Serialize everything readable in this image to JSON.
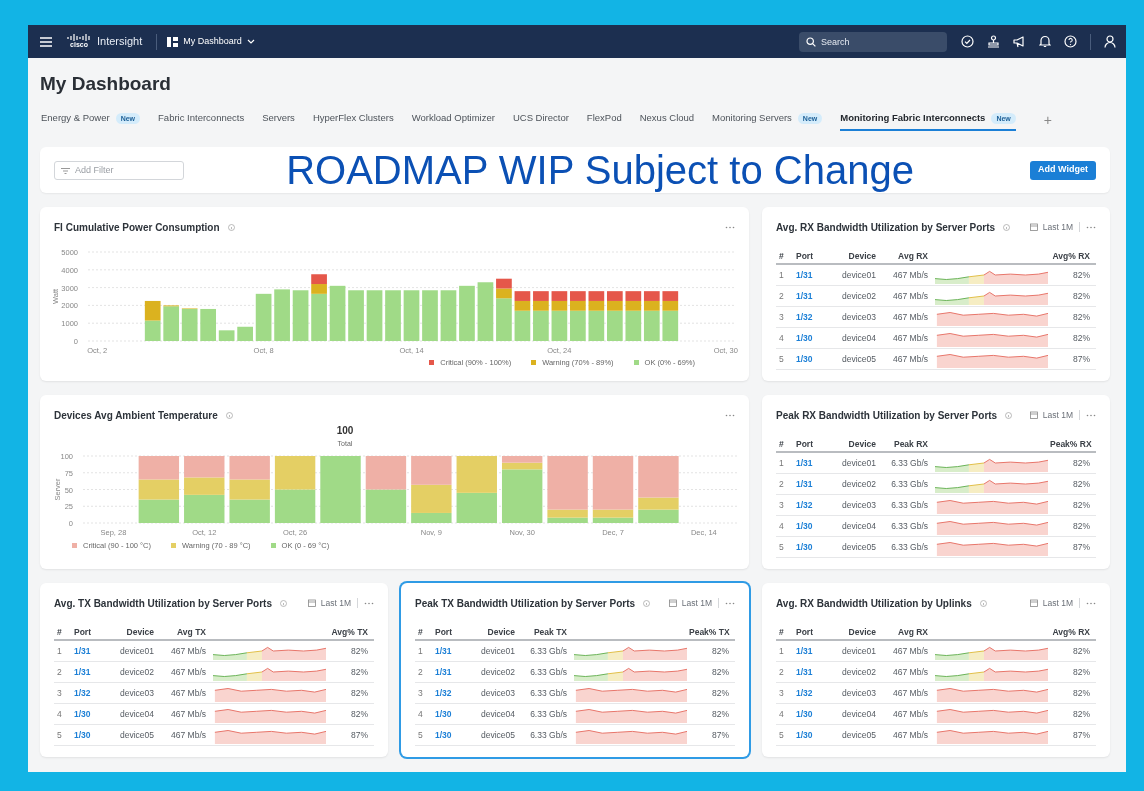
{
  "top_bar": {
    "logo_text": "cisco",
    "product": "Intersight",
    "dashboard_menu": "My Dashboard",
    "search": {
      "placeholder": "Search"
    }
  },
  "page_title": "My Dashboard",
  "tabs": [
    {
      "label": "Energy & Power",
      "badge": "New",
      "selected": false
    },
    {
      "label": "Fabric Interconnects",
      "selected": false
    },
    {
      "label": "Servers",
      "selected": false
    },
    {
      "label": "HyperFlex Clusters",
      "selected": false
    },
    {
      "label": "Workload Optimizer",
      "selected": false
    },
    {
      "label": "UCS Director",
      "selected": false
    },
    {
      "label": "FlexPod",
      "selected": false
    },
    {
      "label": "Nexus Cloud",
      "selected": false
    },
    {
      "label": "Monitoring Servers",
      "badge": "New",
      "selected": false
    },
    {
      "label": "Monitoring Fabric Interconnects",
      "badge": "New",
      "selected": true
    }
  ],
  "add_tab": "+",
  "filter": {
    "placeholder": "Add Filter"
  },
  "add_widget_button": "Add Widget",
  "overlay_notice": "ROADMAP WIP Subject to Change",
  "widgets": [
    {
      "kind": "chart",
      "selected": false,
      "chart_data": {
        "type": "bar",
        "title": "FI Cumulative Power Consumption",
        "ylabel": "Watt",
        "stacked": true,
        "grid": true,
        "ylim": [
          0,
          5000
        ],
        "yticks": [
          0,
          1000,
          2000,
          3000,
          4000,
          5000
        ],
        "categories": [
          "Oct, 2",
          null,
          null,
          null,
          null,
          null,
          null,
          null,
          null,
          "Oct, 8",
          null,
          null,
          null,
          null,
          null,
          null,
          null,
          "Oct, 14",
          null,
          null,
          null,
          null,
          null,
          null,
          null,
          "Oct, 24",
          null,
          null,
          null,
          null,
          null,
          null,
          null,
          null,
          "Oct, 30"
        ],
        "series": [
          {
            "name": "Critical (90% - 100%)",
            "color": "#e5574a",
            "values": [
              null,
              null,
              null,
              0,
              0,
              0,
              0,
              0,
              0,
              0,
              0,
              0,
              550,
              0,
              0,
              0,
              0,
              0,
              0,
              0,
              0,
              0,
              550,
              550,
              550,
              550,
              550,
              550,
              550,
              550,
              550,
              550,
              null,
              null,
              null
            ]
          },
          {
            "name": "Warning (70% - 89%)",
            "color": "#dbb21f",
            "values": [
              null,
              null,
              null,
              1100,
              50,
              30,
              0,
              0,
              0,
              0,
              0,
              0,
              550,
              0,
              0,
              0,
              0,
              0,
              0,
              0,
              0,
              0,
              550,
              550,
              550,
              550,
              550,
              550,
              550,
              550,
              550,
              550,
              null,
              null,
              null
            ]
          },
          {
            "name": "OK (0% - 69%)",
            "color": "#a0da87",
            "values": [
              null,
              null,
              null,
              1150,
              1950,
              1800,
              1800,
              600,
              800,
              2650,
              2900,
              2850,
              2650,
              3100,
              2850,
              2850,
              2850,
              2850,
              2850,
              2850,
              3100,
              3300,
              2400,
              1700,
              1700,
              1700,
              1700,
              1700,
              1700,
              1700,
              1700,
              1700,
              null,
              null,
              null
            ]
          }
        ]
      }
    },
    {
      "kind": "table",
      "title": "Avg. RX Bandwidth Utilization by Server Ports",
      "selected": false,
      "date_range": "Last 1M",
      "columns": [
        "#",
        "Port",
        "Device",
        "Avg RX",
        "Avg% RX"
      ],
      "rows": [
        {
          "index": "1",
          "port": "1/31",
          "device": "device01",
          "value": "467 Mb/s",
          "kind": "mixed",
          "percent": "82%"
        },
        {
          "index": "2",
          "port": "1/31",
          "device": "device02",
          "value": "467 Mb/s",
          "kind": "mixed",
          "percent": "82%"
        },
        {
          "index": "3",
          "port": "1/32",
          "device": "device03",
          "value": "467 Mb/s",
          "kind": "high",
          "percent": "82%"
        },
        {
          "index": "4",
          "port": "1/30",
          "device": "device04",
          "value": "467 Mb/s",
          "kind": "high",
          "percent": "82%"
        },
        {
          "index": "5",
          "port": "1/30",
          "device": "device05",
          "value": "467 Mb/s",
          "kind": "high",
          "percent": "87%"
        }
      ]
    },
    {
      "kind": "chart",
      "selected": false,
      "total": {
        "value": "100",
        "label": "Total"
      },
      "chart_data": {
        "type": "bar",
        "title": "Devices Avg Ambient Temperature",
        "ylabel": "Server",
        "stacked": true,
        "grid": true,
        "ylim": [
          0,
          100
        ],
        "yticks": [
          0,
          25,
          50,
          75,
          100
        ],
        "categories": [
          "Sep, 28",
          null,
          "Oct, 12",
          null,
          "Oct, 26",
          null,
          null,
          "Nov, 9",
          null,
          "Nov, 30",
          null,
          "Dec, 7",
          null,
          "Dec, 14"
        ],
        "series": [
          {
            "name": "Critical (90 - 100 °C)",
            "color": "#efb0a6",
            "values": [
              null,
              35,
              32,
              35,
              0,
              0,
              50,
              43,
              0,
              10,
              80,
              80,
              62,
              null
            ]
          },
          {
            "name": "Warning (70 - 89 °C)",
            "color": "#e4cf64",
            "values": [
              null,
              30,
              26,
              30,
              50,
              0,
              0,
              42,
              55,
              10,
              12,
              12,
              18,
              null
            ]
          },
          {
            "name": "OK (0 - 69 °C)",
            "color": "#a0da87",
            "values": [
              null,
              35,
              42,
              35,
              50,
              100,
              50,
              15,
              45,
              80,
              8,
              8,
              20,
              null
            ]
          }
        ]
      }
    },
    {
      "kind": "table",
      "title": "Peak RX Bandwidth Utilization by Server Ports",
      "selected": false,
      "date_range": "Last 1M",
      "columns": [
        "#",
        "Port",
        "Device",
        "Peak RX",
        "Peak% RX"
      ],
      "rows": [
        {
          "index": "1",
          "port": "1/31",
          "device": "device01",
          "value": "6.33 Gb/s",
          "kind": "mixed",
          "percent": "82%"
        },
        {
          "index": "2",
          "port": "1/31",
          "device": "device02",
          "value": "6.33 Gb/s",
          "kind": "mixed",
          "percent": "82%"
        },
        {
          "index": "3",
          "port": "1/32",
          "device": "device03",
          "value": "6.33 Gb/s",
          "kind": "high",
          "percent": "82%"
        },
        {
          "index": "4",
          "port": "1/30",
          "device": "device04",
          "value": "6.33 Gb/s",
          "kind": "high",
          "percent": "82%"
        },
        {
          "index": "5",
          "port": "1/30",
          "device": "device05",
          "value": "6.33 Gb/s",
          "kind": "high",
          "percent": "87%"
        }
      ]
    },
    {
      "kind": "table",
      "title": "Avg. TX Bandwidth Utilization by Server Ports",
      "selected": false,
      "date_range": "Last 1M",
      "columns": [
        "#",
        "Port",
        "Device",
        "Avg TX",
        "Avg% TX"
      ],
      "rows": [
        {
          "index": "1",
          "port": "1/31",
          "device": "device01",
          "value": "467 Mb/s",
          "kind": "mixed",
          "percent": "82%"
        },
        {
          "index": "2",
          "port": "1/31",
          "device": "device02",
          "value": "467 Mb/s",
          "kind": "mixed",
          "percent": "82%"
        },
        {
          "index": "3",
          "port": "1/32",
          "device": "device03",
          "value": "467 Mb/s",
          "kind": "high",
          "percent": "82%"
        },
        {
          "index": "4",
          "port": "1/30",
          "device": "device04",
          "value": "467 Mb/s",
          "kind": "high",
          "percent": "82%"
        },
        {
          "index": "5",
          "port": "1/30",
          "device": "device05",
          "value": "467 Mb/s",
          "kind": "high",
          "percent": "87%"
        }
      ]
    },
    {
      "kind": "table",
      "title": "Peak TX Bandwidth Utilization by Server Ports",
      "selected": true,
      "date_range": "Last 1M",
      "columns": [
        "#",
        "Port",
        "Device",
        "Peak TX",
        "Peak% TX"
      ],
      "rows": [
        {
          "index": "1",
          "port": "1/31",
          "device": "device01",
          "value": "6.33 Gb/s",
          "kind": "mixed",
          "percent": "82%"
        },
        {
          "index": "2",
          "port": "1/31",
          "device": "device02",
          "value": "6.33 Gb/s",
          "kind": "mixed",
          "percent": "82%"
        },
        {
          "index": "3",
          "port": "1/32",
          "device": "device03",
          "value": "6.33 Gb/s",
          "kind": "high",
          "percent": "82%"
        },
        {
          "index": "4",
          "port": "1/30",
          "device": "device04",
          "value": "6.33 Gb/s",
          "kind": "high",
          "percent": "82%"
        },
        {
          "index": "5",
          "port": "1/30",
          "device": "device05",
          "value": "6.33 Gb/s",
          "kind": "high",
          "percent": "87%"
        }
      ]
    },
    {
      "kind": "table",
      "title": "Avg. RX Bandwidth Utilization by Uplinks",
      "selected": false,
      "date_range": "Last 1M",
      "columns": [
        "#",
        "Port",
        "Device",
        "Avg RX",
        "Avg% RX"
      ],
      "rows": [
        {
          "index": "1",
          "port": "1/31",
          "device": "device01",
          "value": "467 Mb/s",
          "kind": "mixed",
          "percent": "82%"
        },
        {
          "index": "2",
          "port": "1/31",
          "device": "device02",
          "value": "467 Mb/s",
          "kind": "mixed",
          "percent": "82%"
        },
        {
          "index": "3",
          "port": "1/32",
          "device": "device03",
          "value": "467 Mb/s",
          "kind": "high",
          "percent": "82%"
        },
        {
          "index": "4",
          "port": "1/30",
          "device": "device04",
          "value": "467 Mb/s",
          "kind": "high",
          "percent": "82%"
        },
        {
          "index": "5",
          "port": "1/30",
          "device": "device05",
          "value": "467 Mb/s",
          "kind": "high",
          "percent": "87%"
        }
      ]
    }
  ]
}
